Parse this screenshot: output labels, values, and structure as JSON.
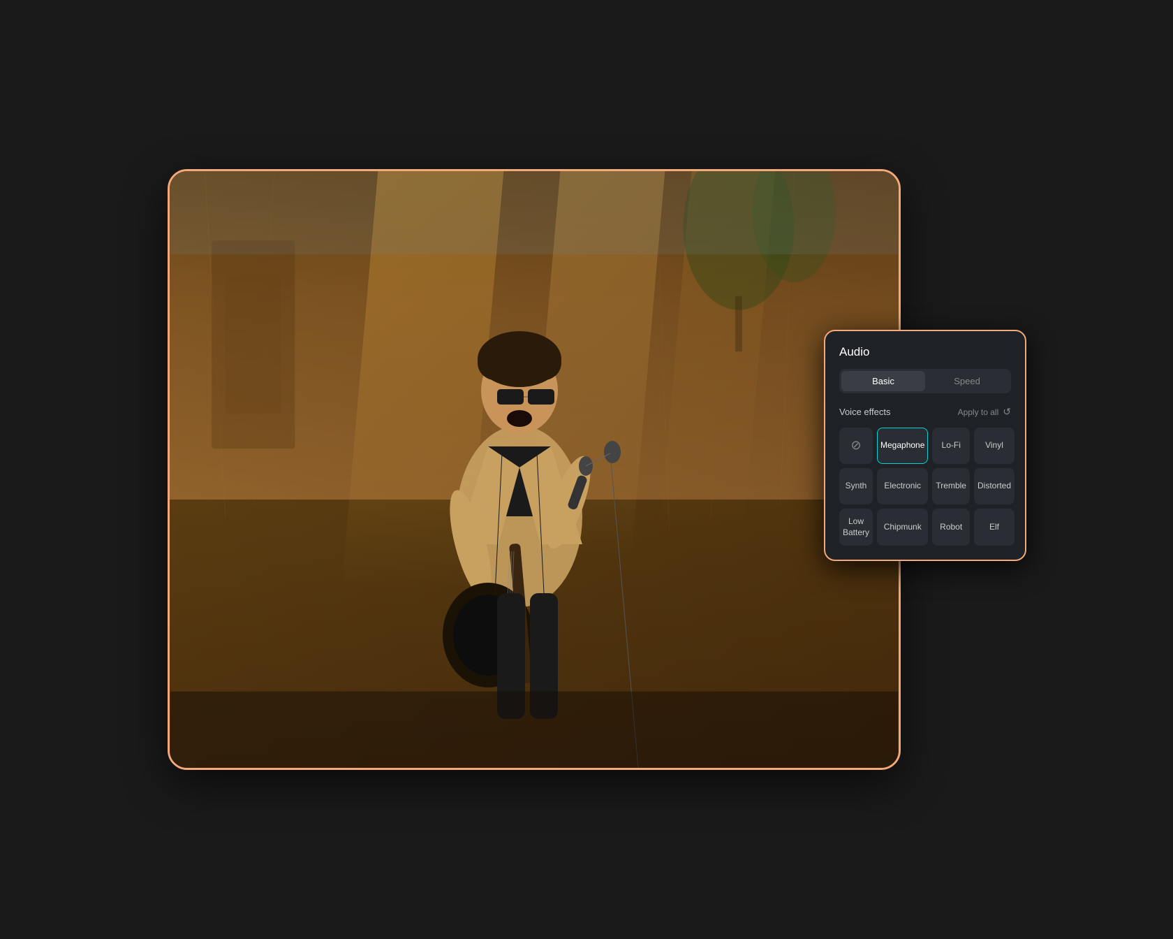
{
  "panel": {
    "title": "Audio",
    "tabs": [
      {
        "id": "basic",
        "label": "Basic",
        "active": true
      },
      {
        "id": "speed",
        "label": "Speed",
        "active": false
      }
    ],
    "voice_effects": {
      "section_label": "Voice effects",
      "apply_all_label": "Apply to all",
      "effects": [
        {
          "id": "none",
          "label": "⊘",
          "is_none": true,
          "selected": false
        },
        {
          "id": "megaphone",
          "label": "Megaphone",
          "selected": true
        },
        {
          "id": "lofi",
          "label": "Lo-Fi",
          "selected": false
        },
        {
          "id": "vinyl",
          "label": "Vinyl",
          "selected": false
        },
        {
          "id": "synth",
          "label": "Synth",
          "selected": false
        },
        {
          "id": "electronic",
          "label": "Electronic",
          "selected": false
        },
        {
          "id": "tremble",
          "label": "Tremble",
          "selected": false
        },
        {
          "id": "distorted",
          "label": "Distorted",
          "selected": false
        },
        {
          "id": "low_battery",
          "label": "Low Battery",
          "selected": false
        },
        {
          "id": "chipmunk",
          "label": "Chipmunk",
          "selected": false
        },
        {
          "id": "robot",
          "label": "Robot",
          "selected": false
        },
        {
          "id": "elf",
          "label": "Elf",
          "selected": false
        }
      ]
    }
  },
  "colors": {
    "panel_bg": "#1e2126",
    "tab_active_bg": "#3a3d44",
    "effect_bg": "#2a2d33",
    "effect_selected_border": "#00d4d4",
    "accent_border": "#f5a97a",
    "text_primary": "#ffffff",
    "text_secondary": "#cccccc",
    "text_muted": "#888888"
  }
}
